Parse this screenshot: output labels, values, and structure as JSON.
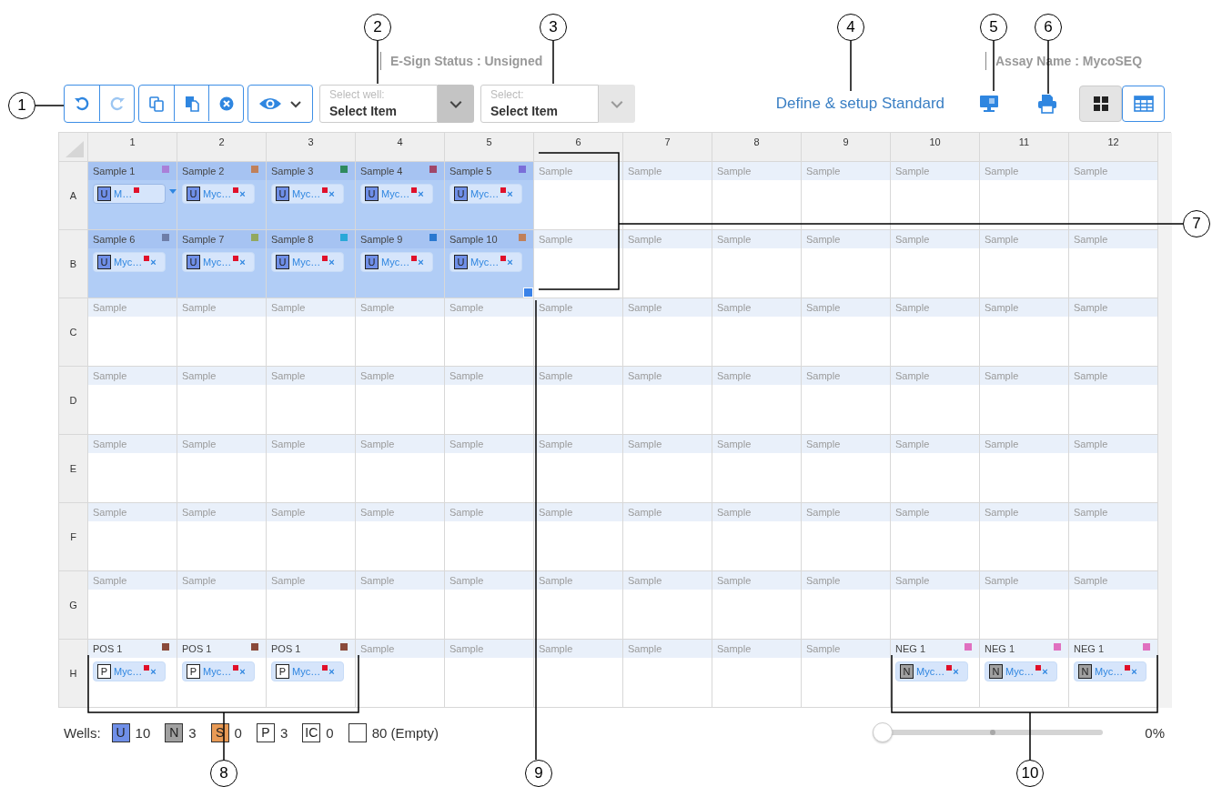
{
  "status": {
    "esign": "E-Sign Status : Unsigned",
    "assay": "Assay Name : MycoSEQ"
  },
  "toolbar": {
    "undo": {
      "disabled": false
    },
    "redo": {
      "disabled": true
    },
    "well_select": {
      "label": "Select well:",
      "value": "Select Item",
      "disabled": false
    },
    "item_select": {
      "label": "Select:",
      "value": "Select Item",
      "disabled": true
    },
    "link": "Define & setup Standard",
    "views": [
      {
        "kind": "grid",
        "selected": false
      },
      {
        "kind": "table",
        "selected": true
      }
    ]
  },
  "plate": {
    "columns": [
      "1",
      "2",
      "3",
      "4",
      "5",
      "6",
      "7",
      "8",
      "9",
      "10",
      "11",
      "12"
    ],
    "rows": [
      {
        "label": "A",
        "wells": [
          {
            "name": "Sample 1",
            "color": "#a97fd8",
            "selected": true,
            "targets": [
              {
                "kind": "U",
                "badge": "U",
                "label": "M…",
                "focused": true
              }
            ]
          },
          {
            "name": "Sample 2",
            "color": "#c0805a",
            "selected": true,
            "targets": [
              {
                "kind": "U",
                "badge": "U",
                "label": "Myc…",
                "focused": false,
                "remove": "×"
              }
            ]
          },
          {
            "name": "Sample 3",
            "color": "#2e8a5e",
            "selected": true,
            "targets": [
              {
                "kind": "U",
                "badge": "U",
                "label": "Myc…",
                "focused": false,
                "remove": "×"
              }
            ]
          },
          {
            "name": "Sample 4",
            "color": "#a04668",
            "selected": true,
            "targets": [
              {
                "kind": "U",
                "badge": "U",
                "label": "Myc…",
                "focused": false,
                "remove": "×"
              }
            ]
          },
          {
            "name": "Sample 5",
            "color": "#7a6ed8",
            "selected": true,
            "targets": [
              {
                "kind": "U",
                "badge": "U",
                "label": "Myc…",
                "focused": false,
                "remove": "×"
              }
            ]
          },
          {
            "placeholder": "Sample",
            "selected": false
          },
          {
            "placeholder": "Sample",
            "selected": false
          },
          {
            "placeholder": "Sample",
            "selected": false
          },
          {
            "placeholder": "Sample",
            "selected": false
          },
          {
            "placeholder": "Sample",
            "selected": false
          },
          {
            "placeholder": "Sample",
            "selected": false
          },
          {
            "placeholder": "Sample",
            "selected": false
          }
        ]
      },
      {
        "label": "B",
        "wells": [
          {
            "name": "Sample 6",
            "color": "#6e7ea8",
            "selected": true,
            "targets": [
              {
                "kind": "U",
                "badge": "U",
                "label": "Myc…",
                "focused": false,
                "remove": "×"
              }
            ]
          },
          {
            "name": "Sample 7",
            "color": "#92a860",
            "selected": true,
            "targets": [
              {
                "kind": "U",
                "badge": "U",
                "label": "Myc…",
                "focused": false,
                "remove": "×"
              }
            ]
          },
          {
            "name": "Sample 8",
            "color": "#2aa8d8",
            "selected": true,
            "targets": [
              {
                "kind": "U",
                "badge": "U",
                "label": "Myc…",
                "focused": false,
                "remove": "×"
              }
            ]
          },
          {
            "name": "Sample 9",
            "color": "#2a78d0",
            "selected": true,
            "targets": [
              {
                "kind": "U",
                "badge": "U",
                "label": "Myc…",
                "focused": false,
                "remove": "×"
              }
            ]
          },
          {
            "name": "Sample 10",
            "color": "#c0805a",
            "selected": true,
            "fill_handle": true,
            "targets": [
              {
                "kind": "U",
                "badge": "U",
                "label": "Myc…",
                "focused": false,
                "remove": "×"
              }
            ]
          },
          {
            "placeholder": "Sample",
            "selected": false
          },
          {
            "placeholder": "Sample",
            "selected": false
          },
          {
            "placeholder": "Sample",
            "selected": false
          },
          {
            "placeholder": "Sample",
            "selected": false
          },
          {
            "placeholder": "Sample",
            "selected": false
          },
          {
            "placeholder": "Sample",
            "selected": false
          },
          {
            "placeholder": "Sample",
            "selected": false
          }
        ]
      },
      {
        "label": "C",
        "wells": [
          {
            "placeholder": "Sample",
            "selected": false
          },
          {
            "placeholder": "Sample",
            "selected": false
          },
          {
            "placeholder": "Sample",
            "selected": false
          },
          {
            "placeholder": "Sample",
            "selected": false
          },
          {
            "placeholder": "Sample",
            "selected": false
          },
          {
            "placeholder": "Sample",
            "selected": false
          },
          {
            "placeholder": "Sample",
            "selected": false
          },
          {
            "placeholder": "Sample",
            "selected": false
          },
          {
            "placeholder": "Sample",
            "selected": false
          },
          {
            "placeholder": "Sample",
            "selected": false
          },
          {
            "placeholder": "Sample",
            "selected": false
          },
          {
            "placeholder": "Sample",
            "selected": false
          }
        ]
      },
      {
        "label": "D",
        "wells": [
          {
            "placeholder": "Sample",
            "selected": false
          },
          {
            "placeholder": "Sample",
            "selected": false
          },
          {
            "placeholder": "Sample",
            "selected": false
          },
          {
            "placeholder": "Sample",
            "selected": false
          },
          {
            "placeholder": "Sample",
            "selected": false
          },
          {
            "placeholder": "Sample",
            "selected": false
          },
          {
            "placeholder": "Sample",
            "selected": false
          },
          {
            "placeholder": "Sample",
            "selected": false
          },
          {
            "placeholder": "Sample",
            "selected": false
          },
          {
            "placeholder": "Sample",
            "selected": false
          },
          {
            "placeholder": "Sample",
            "selected": false
          },
          {
            "placeholder": "Sample",
            "selected": false
          }
        ]
      },
      {
        "label": "E",
        "wells": [
          {
            "placeholder": "Sample",
            "selected": false
          },
          {
            "placeholder": "Sample",
            "selected": false
          },
          {
            "placeholder": "Sample",
            "selected": false
          },
          {
            "placeholder": "Sample",
            "selected": false
          },
          {
            "placeholder": "Sample",
            "selected": false
          },
          {
            "placeholder": "Sample",
            "selected": false
          },
          {
            "placeholder": "Sample",
            "selected": false
          },
          {
            "placeholder": "Sample",
            "selected": false
          },
          {
            "placeholder": "Sample",
            "selected": false
          },
          {
            "placeholder": "Sample",
            "selected": false
          },
          {
            "placeholder": "Sample",
            "selected": false
          },
          {
            "placeholder": "Sample",
            "selected": false
          }
        ]
      },
      {
        "label": "F",
        "wells": [
          {
            "placeholder": "Sample",
            "selected": false
          },
          {
            "placeholder": "Sample",
            "selected": false
          },
          {
            "placeholder": "Sample",
            "selected": false
          },
          {
            "placeholder": "Sample",
            "selected": false
          },
          {
            "placeholder": "Sample",
            "selected": false
          },
          {
            "placeholder": "Sample",
            "selected": false
          },
          {
            "placeholder": "Sample",
            "selected": false
          },
          {
            "placeholder": "Sample",
            "selected": false
          },
          {
            "placeholder": "Sample",
            "selected": false
          },
          {
            "placeholder": "Sample",
            "selected": false
          },
          {
            "placeholder": "Sample",
            "selected": false
          },
          {
            "placeholder": "Sample",
            "selected": false
          }
        ]
      },
      {
        "label": "G",
        "wells": [
          {
            "placeholder": "Sample",
            "selected": false
          },
          {
            "placeholder": "Sample",
            "selected": false
          },
          {
            "placeholder": "Sample",
            "selected": false
          },
          {
            "placeholder": "Sample",
            "selected": false
          },
          {
            "placeholder": "Sample",
            "selected": false
          },
          {
            "placeholder": "Sample",
            "selected": false
          },
          {
            "placeholder": "Sample",
            "selected": false
          },
          {
            "placeholder": "Sample",
            "selected": false
          },
          {
            "placeholder": "Sample",
            "selected": false
          },
          {
            "placeholder": "Sample",
            "selected": false
          },
          {
            "placeholder": "Sample",
            "selected": false
          },
          {
            "placeholder": "Sample",
            "selected": false
          }
        ]
      },
      {
        "label": "H",
        "wells": [
          {
            "name": "POS 1",
            "color": "#8a4a3a",
            "selected": false,
            "targets": [
              {
                "kind": "P",
                "badge": "P",
                "label": "Myc…",
                "focused": false,
                "remove": "×"
              }
            ]
          },
          {
            "name": "POS 1",
            "color": "#8a4a3a",
            "selected": false,
            "targets": [
              {
                "kind": "P",
                "badge": "P",
                "label": "Myc…",
                "focused": false,
                "remove": "×"
              }
            ]
          },
          {
            "name": "POS 1",
            "color": "#8a4a3a",
            "selected": false,
            "targets": [
              {
                "kind": "P",
                "badge": "P",
                "label": "Myc…",
                "focused": false,
                "remove": "×"
              }
            ]
          },
          {
            "placeholder": "Sample",
            "selected": false
          },
          {
            "placeholder": "Sample",
            "selected": false
          },
          {
            "placeholder": "Sample",
            "selected": false
          },
          {
            "placeholder": "Sample",
            "selected": false
          },
          {
            "placeholder": "Sample",
            "selected": false
          },
          {
            "placeholder": "Sample",
            "selected": false
          },
          {
            "name": "NEG 1",
            "color": "#e070c0",
            "selected": false,
            "targets": [
              {
                "kind": "N",
                "badge": "N",
                "label": "Myc…",
                "focused": false,
                "remove": "×"
              }
            ]
          },
          {
            "name": "NEG 1",
            "color": "#e070c0",
            "selected": false,
            "targets": [
              {
                "kind": "N",
                "badge": "N",
                "label": "Myc…",
                "focused": false,
                "remove": "×"
              }
            ]
          },
          {
            "name": "NEG 1",
            "color": "#e070c0",
            "selected": false,
            "targets": [
              {
                "kind": "N",
                "badge": "N",
                "label": "Myc…",
                "focused": false,
                "remove": "×"
              }
            ]
          }
        ]
      }
    ]
  },
  "legend": {
    "label": "Wells:",
    "items": [
      {
        "kind": "U",
        "badge": "U",
        "count": "10"
      },
      {
        "kind": "N",
        "badge": "N",
        "count": "3"
      },
      {
        "kind": "S",
        "badge": "S",
        "count": "0"
      },
      {
        "kind": "P",
        "badge": "P",
        "count": "3"
      },
      {
        "kind": "IC",
        "badge": "IC",
        "count": "0"
      },
      {
        "kind": "empty",
        "count": "80 (Empty)"
      }
    ]
  },
  "zoom": {
    "level": 0,
    "reading": "0%"
  },
  "callouts": [
    "1",
    "2",
    "3",
    "4",
    "5",
    "6",
    "7",
    "8",
    "9",
    "10"
  ]
}
